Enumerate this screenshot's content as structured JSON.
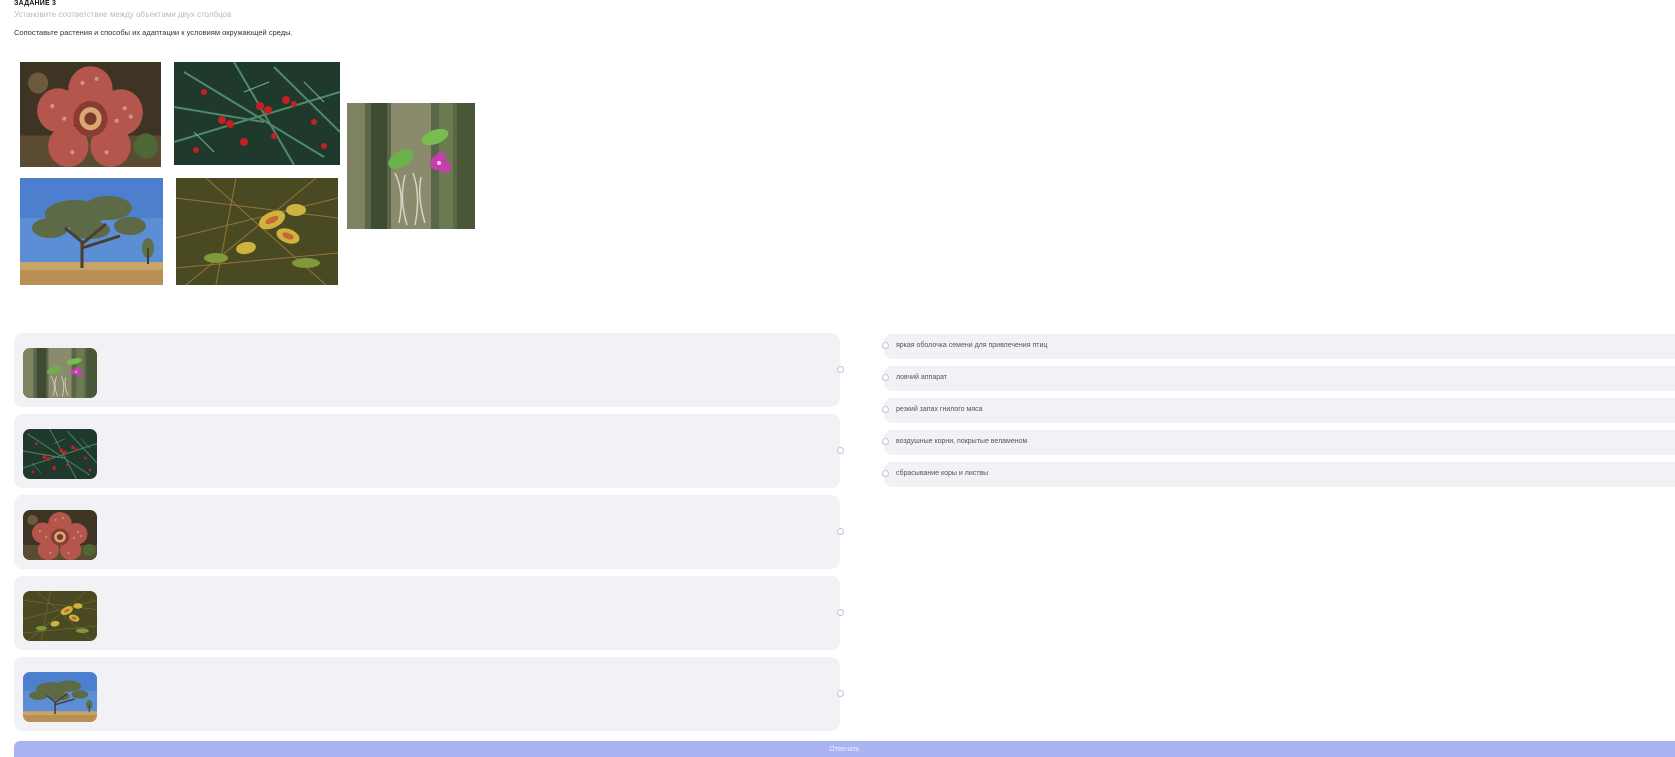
{
  "task": {
    "title": "ЗАДАНИЕ 3",
    "subtitle": "Установите соответствие между объектами двух столбцов",
    "instruction": "Сопоставьте растения и способы их адаптации к условиям окружающей среды."
  },
  "images": [
    "rafflesia-photo",
    "yew-berries-photo",
    "orchid-on-tree-photo",
    "eucalyptus-tree-photo",
    "venus-flytrap-photo"
  ],
  "left_items": [
    {
      "image": "orchid-on-tree-photo"
    },
    {
      "image": "yew-berries-photo"
    },
    {
      "image": "rafflesia-photo"
    },
    {
      "image": "venus-flytrap-photo"
    },
    {
      "image": "eucalyptus-tree-photo"
    }
  ],
  "right_options": [
    {
      "label": "яркая оболочка семени для привлечения птиц"
    },
    {
      "label": "ловчий аппарат"
    },
    {
      "label": "резкий запах гнилого мяса"
    },
    {
      "label": "воздушные корни, покрытые веламеном"
    },
    {
      "label": "сбрасывание коры и листвы"
    }
  ],
  "submit": {
    "label": "Отвечать"
  },
  "colors": {
    "row_background": "#f2f2f6",
    "submit_background": "#aab4f2",
    "subtitle_text": "#b9b9c4"
  }
}
